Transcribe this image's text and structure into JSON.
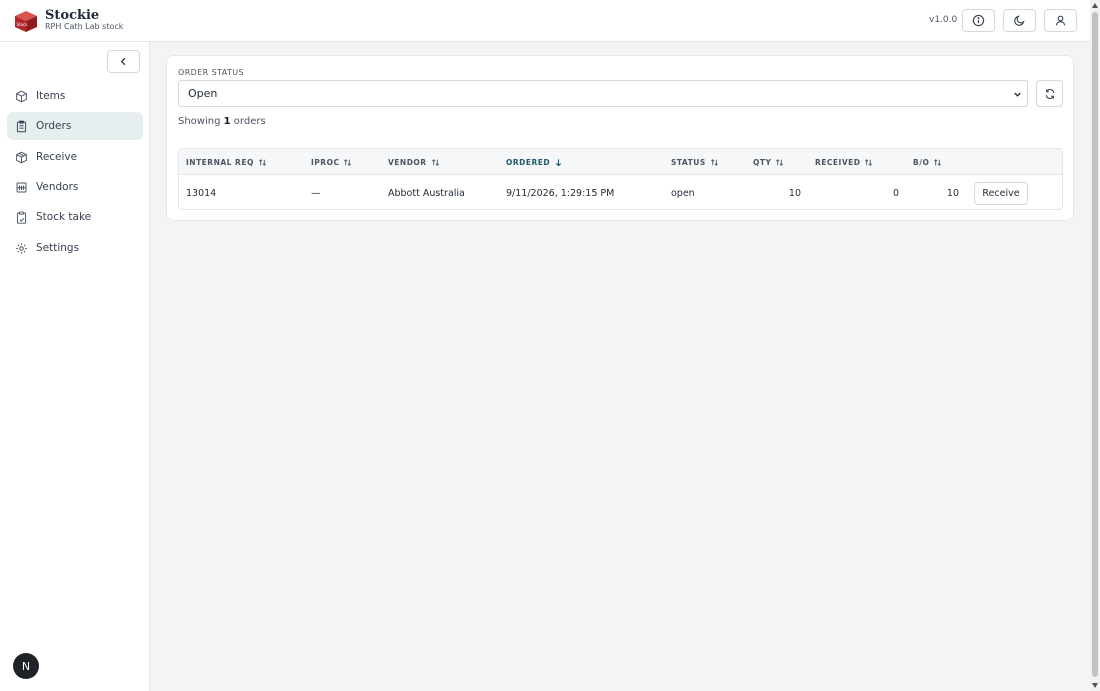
{
  "app": {
    "name": "Stockie",
    "subtitle": "RPH Cath Lab stock",
    "version": "v1.0.0",
    "logo_text": "Stock"
  },
  "header": {
    "buttons": [
      {
        "name": "info",
        "icon": "info-icon"
      },
      {
        "name": "theme",
        "icon": "moon-icon"
      },
      {
        "name": "account",
        "icon": "user-icon"
      }
    ]
  },
  "sidebar": {
    "items": [
      {
        "label": "Items",
        "icon": "box-icon",
        "active": false
      },
      {
        "label": "Orders",
        "icon": "clipboard-icon",
        "active": true
      },
      {
        "label": "Receive",
        "icon": "package-in-icon",
        "active": false
      },
      {
        "label": "Vendors",
        "icon": "building-icon",
        "active": false
      },
      {
        "label": "Stock take",
        "icon": "clipboard-check-icon",
        "active": false
      },
      {
        "label": "Settings",
        "icon": "gear-icon",
        "active": false
      }
    ],
    "avatar_initial": "N"
  },
  "filter": {
    "label": "ORDER STATUS",
    "selected": "Open"
  },
  "summary": {
    "prefix": "Showing",
    "count": "1",
    "suffix": "orders"
  },
  "table": {
    "columns": [
      {
        "label": "INTERNAL REQ",
        "sort": "none"
      },
      {
        "label": "IPROC",
        "sort": "none"
      },
      {
        "label": "VENDOR",
        "sort": "none"
      },
      {
        "label": "ORDERED",
        "sort": "desc"
      },
      {
        "label": "STATUS",
        "sort": "none"
      },
      {
        "label": "QTY",
        "sort": "none"
      },
      {
        "label": "RECEIVED",
        "sort": "none"
      },
      {
        "label": "B/O",
        "sort": "none"
      }
    ],
    "rows": [
      {
        "internal_req": "13014",
        "iproc": "—",
        "vendor": "Abbott Australia",
        "ordered": "9/11/2026, 1:29:15 PM",
        "status": "open",
        "qty": "10",
        "received": "0",
        "bo": "10",
        "action": "Receive"
      }
    ]
  },
  "colors": {
    "accent": "#1f5a6a",
    "active_nav_bg": "#e6eef0",
    "logo_red": "#b3262c"
  }
}
